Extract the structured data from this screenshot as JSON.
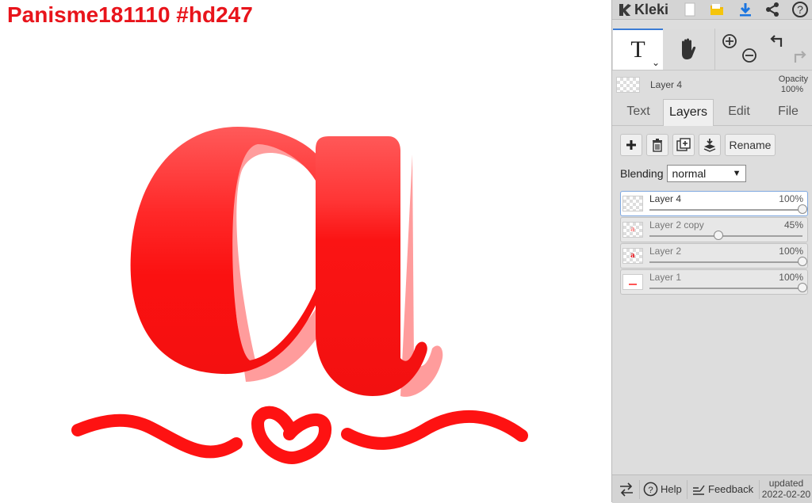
{
  "canvas": {
    "title": "Panisme181110 #hd247"
  },
  "app": {
    "name": "Kleki"
  },
  "topbar": {
    "icons": [
      "new-image-icon",
      "open-folder-icon",
      "download-icon",
      "share-icon",
      "help-icon"
    ]
  },
  "toolbar": {
    "text_tool_glyph": "T",
    "tools": [
      "text-tool",
      "hand-tool",
      "zoom-in-out",
      "undo-redo"
    ]
  },
  "current_layer": {
    "name": "Layer 4",
    "opacity_label": "Opacity",
    "opacity_value": "100%"
  },
  "tabs": [
    {
      "label": "Text",
      "active": false
    },
    {
      "label": "Layers",
      "active": true
    },
    {
      "label": "Edit",
      "active": false
    },
    {
      "label": "File",
      "active": false
    }
  ],
  "layer_buttons": {
    "rename_label": "Rename"
  },
  "blending": {
    "label": "Blending",
    "value": "normal"
  },
  "layers": [
    {
      "name": "Layer 4",
      "opacity": "100%",
      "opacity_value": 100,
      "active": true
    },
    {
      "name": "Layer 2 copy",
      "opacity": "45%",
      "opacity_value": 45,
      "active": false
    },
    {
      "name": "Layer 2",
      "opacity": "100%",
      "opacity_value": 100,
      "active": false
    },
    {
      "name": "Layer 1",
      "opacity": "100%",
      "opacity_value": 100,
      "active": false
    }
  ],
  "bottombar": {
    "help_label": "Help",
    "feedback_label": "Feedback",
    "updated_label": "updated",
    "updated_date": "2022-02-20"
  },
  "colors": {
    "accent_red": "#e8141b",
    "art_red": "#fe1212",
    "shadow_pink": "#ff9a9a",
    "active_tab_bar": "#3a7bd5"
  }
}
